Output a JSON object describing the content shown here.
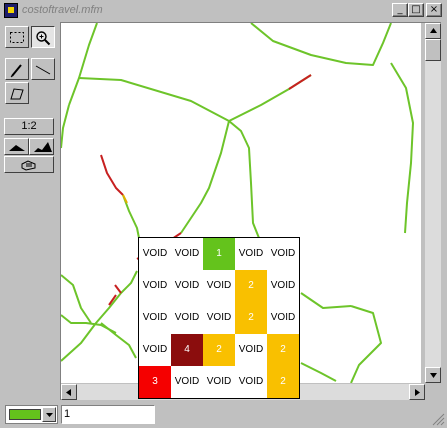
{
  "window": {
    "title": "costoftravel.mfm",
    "minimize_glyph": "_",
    "restore_glyph": "□",
    "close_glyph": "×"
  },
  "toolbar": {
    "tools": [
      {
        "name": "select-rectangle-icon",
        "pressed": false
      },
      {
        "name": "zoom-icon",
        "pressed": true
      },
      {
        "name": "pencil-icon",
        "pressed": false
      },
      {
        "name": "line-icon",
        "pressed": false
      },
      {
        "name": "polygon-icon",
        "pressed": false
      }
    ],
    "scale_label": "1:2",
    "terrain_icons": [
      "terrain-small-icon",
      "terrain-large-icon"
    ],
    "hand_icon": "hand-pointer-icon"
  },
  "map": {
    "road_color": "#6dc42a",
    "road_hot_color": "#c72020",
    "road_warm_color": "#e0b000"
  },
  "cost_grid": {
    "rows": [
      [
        "VOID",
        "VOID",
        "1",
        "VOID",
        "VOID"
      ],
      [
        "VOID",
        "VOID",
        "VOID",
        "2",
        "VOID"
      ],
      [
        "VOID",
        "VOID",
        "VOID",
        "2",
        "VOID"
      ],
      [
        "VOID",
        "4",
        "2",
        "VOID",
        "2"
      ],
      [
        "3",
        "VOID",
        "VOID",
        "VOID",
        "2"
      ]
    ],
    "colors": {
      "1": "#64c31c",
      "2": "#f9c000",
      "3": "#f50000",
      "4": "#8b0d0d"
    }
  },
  "status": {
    "color_value": "#64c31c",
    "input_value": "1"
  }
}
